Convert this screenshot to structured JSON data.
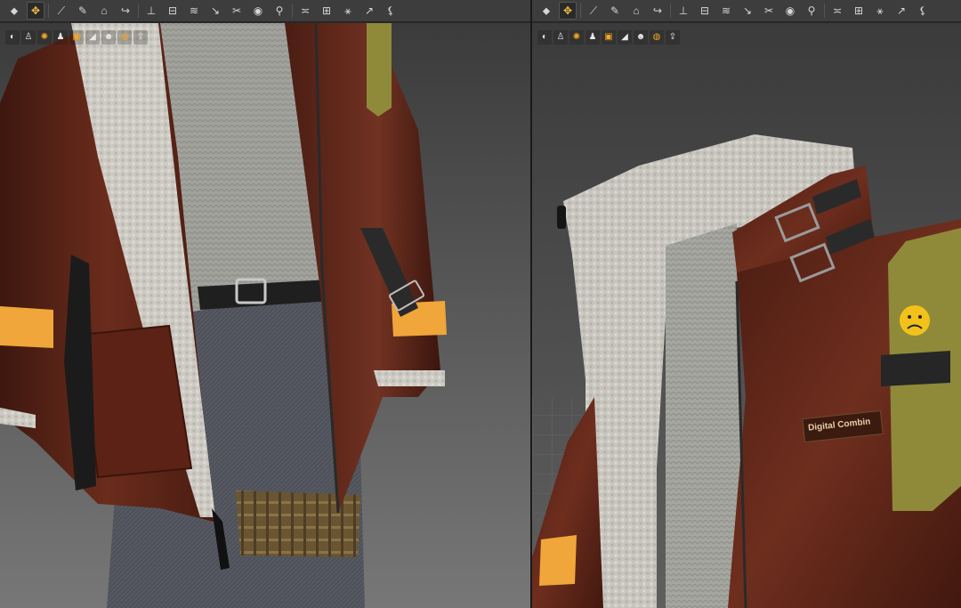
{
  "left_toolbar": {
    "tools": [
      {
        "icon": "select-arrow-icon",
        "glyph": "⬥"
      },
      {
        "icon": "move-icon",
        "glyph": "✥"
      },
      {
        "icon": "brush-icon",
        "glyph": "⟋"
      },
      {
        "icon": "pen-icon",
        "glyph": "✎"
      },
      {
        "icon": "garment-icon",
        "glyph": "⌂"
      },
      {
        "icon": "fold-icon",
        "glyph": "↪"
      },
      {
        "icon": "pin-icon",
        "glyph": "⊥"
      },
      {
        "icon": "segment-icon",
        "glyph": "⊟"
      },
      {
        "icon": "tape-icon",
        "glyph": "≋"
      },
      {
        "icon": "seam-icon",
        "glyph": "↘"
      },
      {
        "icon": "stitch-icon",
        "glyph": "✂"
      },
      {
        "icon": "button-icon",
        "glyph": "◉"
      },
      {
        "icon": "zipper-icon",
        "glyph": "⚲"
      },
      {
        "icon": "puckering-icon",
        "glyph": "≍"
      },
      {
        "icon": "layer-icon",
        "glyph": "⊞"
      },
      {
        "icon": "avatar-pose-icon",
        "glyph": "⚹"
      },
      {
        "icon": "measure-icon",
        "glyph": "↗"
      },
      {
        "icon": "run-icon",
        "glyph": "⚸"
      }
    ]
  },
  "right_toolbar": {
    "tools": [
      {
        "icon": "select-arrow-icon",
        "glyph": "⬥"
      },
      {
        "icon": "move-icon",
        "glyph": "✥"
      },
      {
        "icon": "brush-icon",
        "glyph": "⟋"
      },
      {
        "icon": "pen-icon",
        "glyph": "✎"
      },
      {
        "icon": "garment-icon",
        "glyph": "⌂"
      },
      {
        "icon": "fold-icon",
        "glyph": "↪"
      },
      {
        "icon": "pin-icon",
        "glyph": "⊥"
      },
      {
        "icon": "segment-icon",
        "glyph": "⊟"
      },
      {
        "icon": "tape-icon",
        "glyph": "≋"
      },
      {
        "icon": "seam-icon",
        "glyph": "↘"
      },
      {
        "icon": "stitch-icon",
        "glyph": "✂"
      },
      {
        "icon": "button-icon",
        "glyph": "◉"
      },
      {
        "icon": "zipper-icon",
        "glyph": "⚲"
      },
      {
        "icon": "puckering-icon",
        "glyph": "≍"
      },
      {
        "icon": "layer-icon",
        "glyph": "⊞"
      },
      {
        "icon": "avatar-pose-icon",
        "glyph": "⚹"
      },
      {
        "icon": "measure-icon",
        "glyph": "↗"
      },
      {
        "icon": "run-icon",
        "glyph": "⚸"
      }
    ]
  },
  "left_viewport_toolbar": {
    "buttons": [
      {
        "icon": "view-avatar-icon",
        "glyph": "◐",
        "color": "#e8e8e8"
      },
      {
        "icon": "view-garment-icon",
        "glyph": "♙",
        "color": "#e8e8e8"
      },
      {
        "icon": "view-texture-icon",
        "glyph": "✺",
        "color": "#f5a623"
      },
      {
        "icon": "view-person-icon",
        "glyph": "♟",
        "color": "#e8e8e8"
      },
      {
        "icon": "view-material-icon",
        "glyph": "▣",
        "color": "#f5a623"
      },
      {
        "icon": "view-light-icon",
        "glyph": "◢",
        "color": "#e8e8e8"
      },
      {
        "icon": "view-avatar-2-icon",
        "glyph": "☻",
        "color": "#e8e8e8"
      },
      {
        "icon": "view-render-icon",
        "glyph": "◍",
        "color": "#f5a623"
      },
      {
        "icon": "view-export-icon",
        "glyph": "⇪",
        "color": "#e8e8e8"
      }
    ]
  },
  "right_viewport_toolbar": {
    "buttons": [
      {
        "icon": "view-avatar-icon",
        "glyph": "◐",
        "color": "#e8e8e8"
      },
      {
        "icon": "view-garment-icon",
        "glyph": "♙",
        "color": "#e8e8e8"
      },
      {
        "icon": "view-texture-icon",
        "glyph": "✺",
        "color": "#f5a623"
      },
      {
        "icon": "view-person-icon",
        "glyph": "♟",
        "color": "#e8e8e8"
      },
      {
        "icon": "view-material-icon",
        "glyph": "▣",
        "color": "#f5a623"
      },
      {
        "icon": "view-light-icon",
        "glyph": "◢",
        "color": "#e8e8e8"
      },
      {
        "icon": "view-avatar-2-icon",
        "glyph": "☻",
        "color": "#e8e8e8"
      },
      {
        "icon": "view-render-icon",
        "glyph": "◍",
        "color": "#f5a623"
      },
      {
        "icon": "view-export-icon",
        "glyph": "⇪",
        "color": "#e8e8e8"
      }
    ]
  },
  "scene": {
    "patch_label": "Digital Combin",
    "colors": {
      "leather": "#5a2418",
      "leather_highlight": "#7a3826",
      "sherpa": "#c9c6c0",
      "sweater": "#9d9d98",
      "denim": "#4d5058",
      "strap_orange": "#f0a63a",
      "strap_olive": "#8f8a3a",
      "plaid": "#6f5a36",
      "belt": "#1f1f1f"
    }
  }
}
